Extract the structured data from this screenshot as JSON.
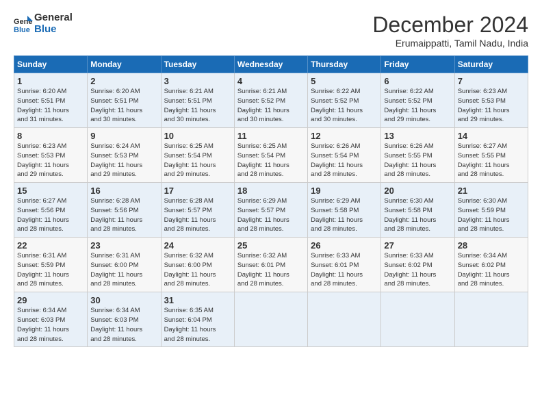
{
  "header": {
    "logo_line1": "General",
    "logo_line2": "Blue",
    "month": "December 2024",
    "location": "Erumaippatti, Tamil Nadu, India"
  },
  "days_of_week": [
    "Sunday",
    "Monday",
    "Tuesday",
    "Wednesday",
    "Thursday",
    "Friday",
    "Saturday"
  ],
  "weeks": [
    [
      {
        "day": "1",
        "info": "Sunrise: 6:20 AM\nSunset: 5:51 PM\nDaylight: 11 hours\nand 31 minutes."
      },
      {
        "day": "2",
        "info": "Sunrise: 6:20 AM\nSunset: 5:51 PM\nDaylight: 11 hours\nand 30 minutes."
      },
      {
        "day": "3",
        "info": "Sunrise: 6:21 AM\nSunset: 5:51 PM\nDaylight: 11 hours\nand 30 minutes."
      },
      {
        "day": "4",
        "info": "Sunrise: 6:21 AM\nSunset: 5:52 PM\nDaylight: 11 hours\nand 30 minutes."
      },
      {
        "day": "5",
        "info": "Sunrise: 6:22 AM\nSunset: 5:52 PM\nDaylight: 11 hours\nand 30 minutes."
      },
      {
        "day": "6",
        "info": "Sunrise: 6:22 AM\nSunset: 5:52 PM\nDaylight: 11 hours\nand 29 minutes."
      },
      {
        "day": "7",
        "info": "Sunrise: 6:23 AM\nSunset: 5:53 PM\nDaylight: 11 hours\nand 29 minutes."
      }
    ],
    [
      {
        "day": "8",
        "info": "Sunrise: 6:23 AM\nSunset: 5:53 PM\nDaylight: 11 hours\nand 29 minutes."
      },
      {
        "day": "9",
        "info": "Sunrise: 6:24 AM\nSunset: 5:53 PM\nDaylight: 11 hours\nand 29 minutes."
      },
      {
        "day": "10",
        "info": "Sunrise: 6:25 AM\nSunset: 5:54 PM\nDaylight: 11 hours\nand 29 minutes."
      },
      {
        "day": "11",
        "info": "Sunrise: 6:25 AM\nSunset: 5:54 PM\nDaylight: 11 hours\nand 28 minutes."
      },
      {
        "day": "12",
        "info": "Sunrise: 6:26 AM\nSunset: 5:54 PM\nDaylight: 11 hours\nand 28 minutes."
      },
      {
        "day": "13",
        "info": "Sunrise: 6:26 AM\nSunset: 5:55 PM\nDaylight: 11 hours\nand 28 minutes."
      },
      {
        "day": "14",
        "info": "Sunrise: 6:27 AM\nSunset: 5:55 PM\nDaylight: 11 hours\nand 28 minutes."
      }
    ],
    [
      {
        "day": "15",
        "info": "Sunrise: 6:27 AM\nSunset: 5:56 PM\nDaylight: 11 hours\nand 28 minutes."
      },
      {
        "day": "16",
        "info": "Sunrise: 6:28 AM\nSunset: 5:56 PM\nDaylight: 11 hours\nand 28 minutes."
      },
      {
        "day": "17",
        "info": "Sunrise: 6:28 AM\nSunset: 5:57 PM\nDaylight: 11 hours\nand 28 minutes."
      },
      {
        "day": "18",
        "info": "Sunrise: 6:29 AM\nSunset: 5:57 PM\nDaylight: 11 hours\nand 28 minutes."
      },
      {
        "day": "19",
        "info": "Sunrise: 6:29 AM\nSunset: 5:58 PM\nDaylight: 11 hours\nand 28 minutes."
      },
      {
        "day": "20",
        "info": "Sunrise: 6:30 AM\nSunset: 5:58 PM\nDaylight: 11 hours\nand 28 minutes."
      },
      {
        "day": "21",
        "info": "Sunrise: 6:30 AM\nSunset: 5:59 PM\nDaylight: 11 hours\nand 28 minutes."
      }
    ],
    [
      {
        "day": "22",
        "info": "Sunrise: 6:31 AM\nSunset: 5:59 PM\nDaylight: 11 hours\nand 28 minutes."
      },
      {
        "day": "23",
        "info": "Sunrise: 6:31 AM\nSunset: 6:00 PM\nDaylight: 11 hours\nand 28 minutes."
      },
      {
        "day": "24",
        "info": "Sunrise: 6:32 AM\nSunset: 6:00 PM\nDaylight: 11 hours\nand 28 minutes."
      },
      {
        "day": "25",
        "info": "Sunrise: 6:32 AM\nSunset: 6:01 PM\nDaylight: 11 hours\nand 28 minutes."
      },
      {
        "day": "26",
        "info": "Sunrise: 6:33 AM\nSunset: 6:01 PM\nDaylight: 11 hours\nand 28 minutes."
      },
      {
        "day": "27",
        "info": "Sunrise: 6:33 AM\nSunset: 6:02 PM\nDaylight: 11 hours\nand 28 minutes."
      },
      {
        "day": "28",
        "info": "Sunrise: 6:34 AM\nSunset: 6:02 PM\nDaylight: 11 hours\nand 28 minutes."
      }
    ],
    [
      {
        "day": "29",
        "info": "Sunrise: 6:34 AM\nSunset: 6:03 PM\nDaylight: 11 hours\nand 28 minutes."
      },
      {
        "day": "30",
        "info": "Sunrise: 6:34 AM\nSunset: 6:03 PM\nDaylight: 11 hours\nand 28 minutes."
      },
      {
        "day": "31",
        "info": "Sunrise: 6:35 AM\nSunset: 6:04 PM\nDaylight: 11 hours\nand 28 minutes."
      },
      {
        "day": "",
        "info": ""
      },
      {
        "day": "",
        "info": ""
      },
      {
        "day": "",
        "info": ""
      },
      {
        "day": "",
        "info": ""
      }
    ]
  ]
}
